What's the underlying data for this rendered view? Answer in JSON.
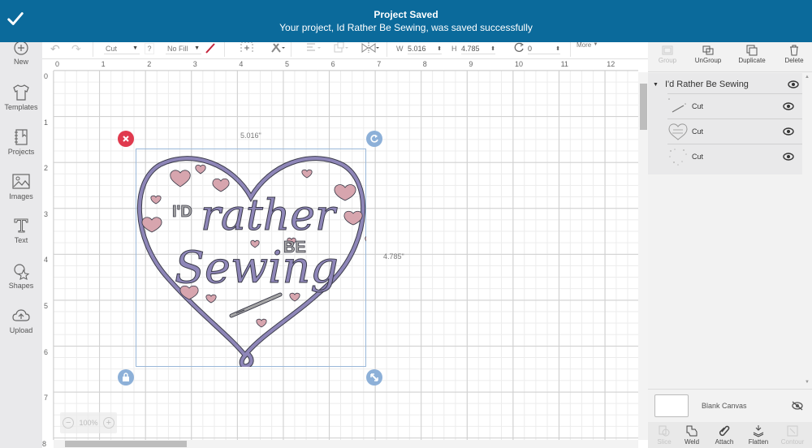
{
  "toast": {
    "title": "Project Saved",
    "message": "Your project, Id Rather Be Sewing, was saved successfully",
    "icon": "check-icon",
    "color": "#0b6a9b"
  },
  "sidebar": {
    "items": [
      {
        "label": "New",
        "icon": "plus-circle-icon"
      },
      {
        "label": "Templates",
        "icon": "tshirt-icon"
      },
      {
        "label": "Projects",
        "icon": "notebook-icon"
      },
      {
        "label": "Images",
        "icon": "image-icon"
      },
      {
        "label": "Text",
        "icon": "text-icon"
      },
      {
        "label": "Shapes",
        "icon": "shapes-icon"
      },
      {
        "label": "Upload",
        "icon": "cloud-upload-icon"
      }
    ]
  },
  "toolbar": {
    "linetype": "Cut",
    "help": "?",
    "fill": "No Fill",
    "width_label": "W",
    "width_value": "5.016",
    "height_label": "H",
    "height_value": "4.785",
    "rotate_value": "0",
    "more_label": "More"
  },
  "ruler": {
    "top": [
      "0",
      "1",
      "2",
      "3",
      "4",
      "5",
      "6",
      "7",
      "8",
      "9",
      "10",
      "11",
      "12"
    ],
    "left": [
      "0",
      "1",
      "2",
      "3",
      "4",
      "5",
      "6",
      "7",
      "8"
    ]
  },
  "canvas": {
    "selection_width": "5.016\"",
    "selection_height": "4.785\"",
    "zoom_level": "100%",
    "design": {
      "line1": "I'D",
      "line2": "rather",
      "line3": "BE",
      "line4": "Sewing",
      "colors": {
        "outline": "#8e86b8",
        "hearts": "#d7a5ae",
        "gray": "#a7a7a7",
        "stroke": "#3c3c4a"
      }
    },
    "handle_colors": {
      "delete": "#e03a4e",
      "rotate": "#8db0d8",
      "lock": "#8db0d8",
      "resize": "#8db0d8"
    }
  },
  "right_panel": {
    "actions": [
      {
        "label": "Group",
        "enabled": false
      },
      {
        "label": "UnGroup",
        "enabled": true
      },
      {
        "label": "Duplicate",
        "enabled": true
      },
      {
        "label": "Delete",
        "enabled": true
      }
    ],
    "group_name": "I'd Rather Be Sewing",
    "layers": [
      {
        "label": "Cut",
        "thumb": "needle"
      },
      {
        "label": "Cut",
        "thumb": "heart-text"
      },
      {
        "label": "Cut",
        "thumb": "small-hearts"
      }
    ],
    "canvas_label": "Blank Canvas",
    "bottom_actions": [
      {
        "label": "Slice",
        "enabled": false
      },
      {
        "label": "Weld",
        "enabled": true
      },
      {
        "label": "Attach",
        "enabled": true
      },
      {
        "label": "Flatten",
        "enabled": true
      },
      {
        "label": "Contour",
        "enabled": false
      }
    ]
  }
}
